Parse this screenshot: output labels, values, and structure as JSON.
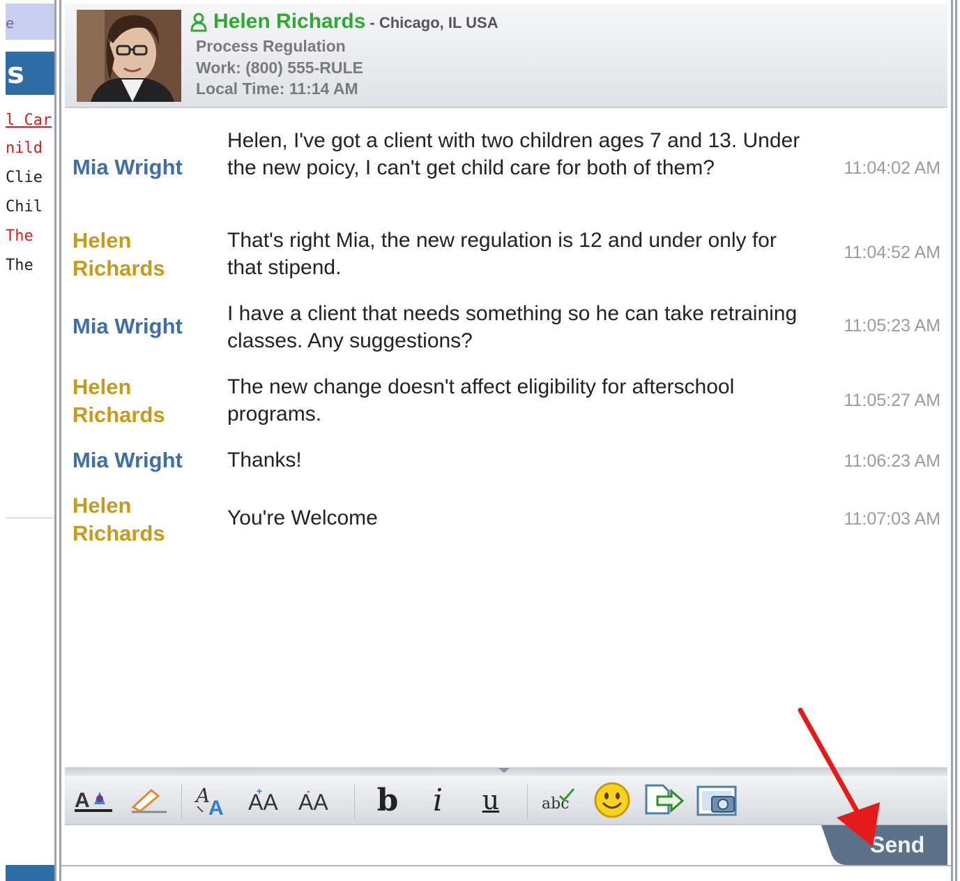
{
  "background_app": {
    "topbar_text": "e",
    "heading_fragment": "s",
    "links": [
      {
        "text": "l Car",
        "color": "#d62020",
        "underline": true
      },
      {
        "text": "nild (",
        "color": "#d62020",
        "underline": false
      },
      {
        "text": "Clie",
        "color": "#222222",
        "underline": false
      },
      {
        "text": "Chil",
        "color": "#222222",
        "underline": false
      },
      {
        "text": "The",
        "color": "#d62020",
        "underline": false
      },
      {
        "text": "The",
        "color": "#222222",
        "underline": false
      }
    ]
  },
  "contact": {
    "name": "Helen Richards",
    "location": "- Chicago, IL USA",
    "department": "Process Regulation",
    "work_phone": "Work: (800) 555-RULE",
    "local_time": "Local Time: 11:14 AM",
    "presence_icon": "person-online-icon",
    "name_color": "#2eaa2e"
  },
  "colors": {
    "mia": "#3e6fa6",
    "helen": "#c79a1c",
    "accent_arrow": "#e31b1b",
    "send_tab": "#5d7188"
  },
  "messages": [
    {
      "sender": "Mia Wright",
      "who": "mia",
      "text": "Helen, I've got a client with two children ages 7 and 13.  Under the new poicy, I can't get child care for both of them?",
      "time": "11:04:02 AM"
    },
    {
      "sender": "Helen Richards",
      "who": "helen",
      "text": "That's right Mia, the new regulation is 12 and under only for that stipend.",
      "time": "11:04:52 AM"
    },
    {
      "sender": "Mia Wright",
      "who": "mia",
      "text": "I have a client that needs something so he can take retraining classes.  Any suggestions?",
      "time": "11:05:23 AM"
    },
    {
      "sender": "Helen Richards",
      "who": "helen",
      "text": "The new change doesn't affect eligibility for afterschool programs.",
      "time": "11:05:27 AM"
    },
    {
      "sender": "Mia Wright",
      "who": "mia",
      "text": "Thanks!",
      "time": "11:06:23 AM"
    },
    {
      "sender": "Helen Richards",
      "who": "helen",
      "text": "You're Welcome",
      "time": "11:07:03 AM"
    }
  ],
  "toolbar": {
    "font_color_glyph": "A",
    "grow_font_glyph": "AA",
    "shrink_font_glyph": "AA",
    "bold_glyph": "b",
    "italic_glyph": "i",
    "underline_glyph": "u",
    "spellcheck_glyph": "abc"
  },
  "composer": {
    "send_label": "Send"
  }
}
